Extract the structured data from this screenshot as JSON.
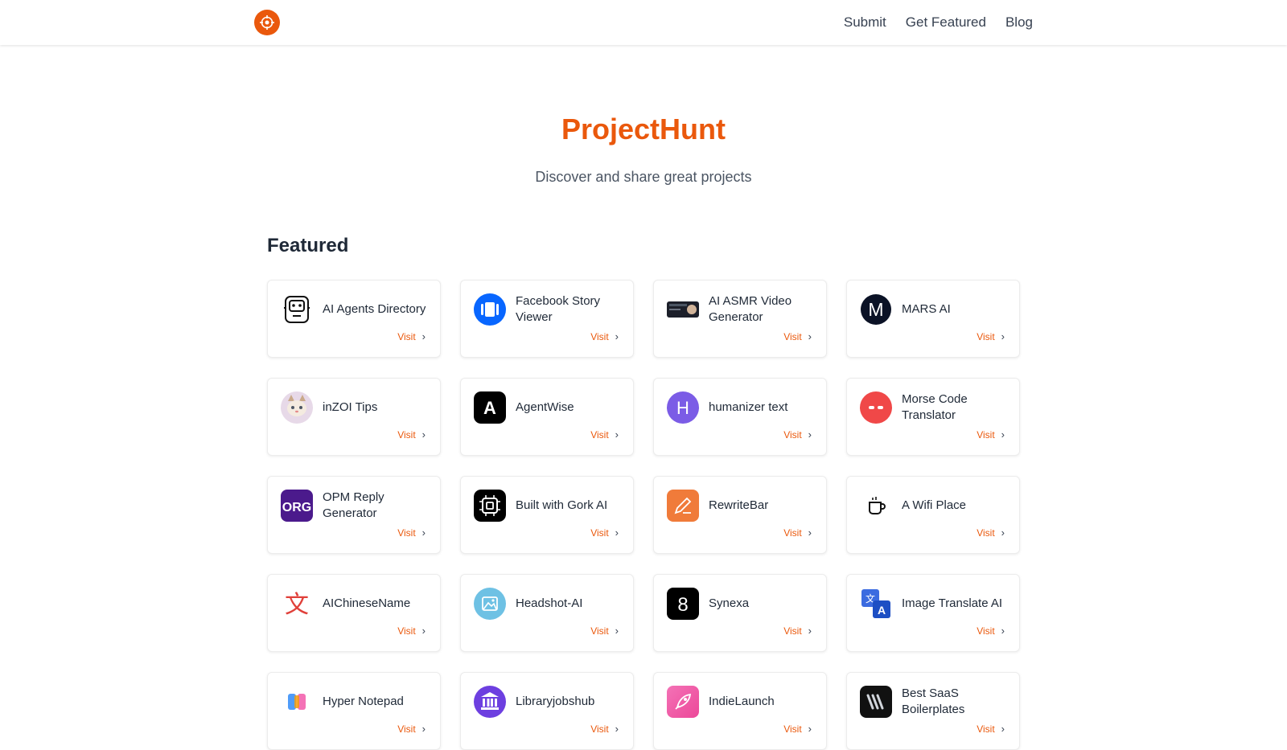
{
  "nav": {
    "logo": "target-logo-icon",
    "links": [
      {
        "label": "Submit"
      },
      {
        "label": "Get Featured"
      },
      {
        "label": "Blog"
      }
    ]
  },
  "hero": {
    "title": "ProjectHunt",
    "subtitle": "Discover and share great projects"
  },
  "section": {
    "title": "Featured"
  },
  "colors": {
    "accent": "#ea580c"
  },
  "projects": [
    {
      "name": "AI Agents Directory",
      "visit": "Visit",
      "icon": "robot-icon"
    },
    {
      "name": "Facebook Story Viewer",
      "visit": "Visit",
      "icon": "story-viewer-icon"
    },
    {
      "name": "AI ASMR Video Generator",
      "visit": "Visit",
      "icon": "video-thumbnail-icon"
    },
    {
      "name": "MARS AI",
      "visit": "Visit",
      "icon": "letter-m-icon"
    },
    {
      "name": "inZOI Tips",
      "visit": "Visit",
      "icon": "cat-avatar-icon"
    },
    {
      "name": "AgentWise",
      "visit": "Visit",
      "icon": "letter-a-icon"
    },
    {
      "name": "humanizer text",
      "visit": "Visit",
      "icon": "letter-h-icon"
    },
    {
      "name": "Morse Code Translator",
      "visit": "Visit",
      "icon": "morse-dash-icon"
    },
    {
      "name": "OPM Reply Generator",
      "visit": "Visit",
      "icon": "org-logo-icon"
    },
    {
      "name": "Built with Gork AI",
      "visit": "Visit",
      "icon": "chip-icon"
    },
    {
      "name": "RewriteBar",
      "visit": "Visit",
      "icon": "pencil-icon"
    },
    {
      "name": "A Wifi Place",
      "visit": "Visit",
      "icon": "coffee-cup-icon"
    },
    {
      "name": "AIChineseName",
      "visit": "Visit",
      "icon": "chinese-character-icon"
    },
    {
      "name": "Headshot-AI",
      "visit": "Visit",
      "icon": "headshot-photo-icon"
    },
    {
      "name": "Synexa",
      "visit": "Visit",
      "icon": "number-eight-icon"
    },
    {
      "name": "Image Translate AI",
      "visit": "Visit",
      "icon": "translate-icon"
    },
    {
      "name": "Hyper Notepad",
      "visit": "Visit",
      "icon": "notepad-icon"
    },
    {
      "name": "Libraryjobshub",
      "visit": "Visit",
      "icon": "library-building-icon"
    },
    {
      "name": "IndieLaunch",
      "visit": "Visit",
      "icon": "rocket-icon"
    },
    {
      "name": "Best SaaS Boilerplates",
      "visit": "Visit",
      "icon": "layers-logo-icon"
    }
  ]
}
